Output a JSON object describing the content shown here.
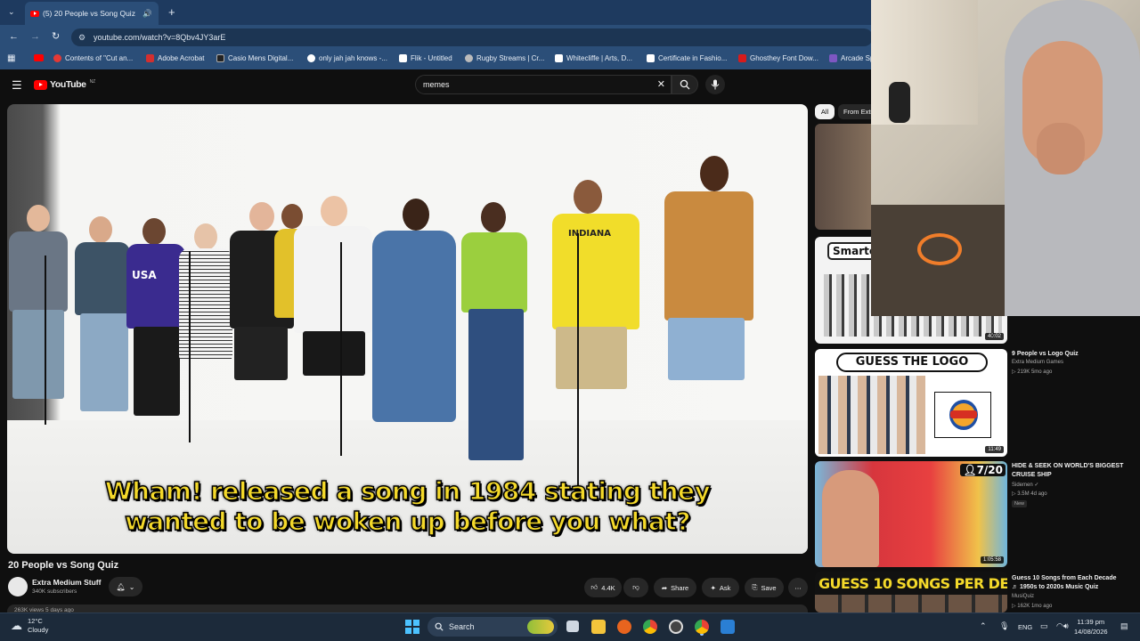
{
  "browser": {
    "tab_title": "(5) 20 People vs Song Quiz",
    "url": "youtube.com/watch?v=8Qbv4JY3arE",
    "bookmarks": [
      "Contents of \"Cut an...",
      "Adobe Acrobat",
      "Casio Mens Digital...",
      "only jah jah knows -...",
      "Flik - Untitled",
      "Rugby Streams | Cr...",
      "Whitecliffe | Arts, D...",
      "Certificate in Fashio...",
      "Ghosthey Font Dow...",
      "Arcade Sp"
    ]
  },
  "youtube": {
    "logo_text": "YouTube",
    "logo_region": "NZ",
    "search_value": "memes"
  },
  "video": {
    "caption_line1": "Wham! released a song in 1984 stating they",
    "caption_line2": "wanted to be woken up before you what?",
    "shirt_text_usa": "USA",
    "shirt_text_indiana": "INDIANA",
    "title": "20 People vs Song Quiz",
    "channel": "Extra Medium Stuff",
    "subscribers": "340K subscribers",
    "likes": "4.4K",
    "share_label": "Share",
    "ask_label": "Ask",
    "save_label": "Save",
    "meta_text": "263K views  5 days ago"
  },
  "sidebar": {
    "chips": [
      "All",
      "From Extra"
    ],
    "items": [
      {
        "thumb_text": "",
        "duration": ""
      },
      {
        "thumb_text": "Smarte",
        "duration": "40:02"
      },
      {
        "thumb_text": "GUESS THE LOGO",
        "duration": "11:49",
        "title": "9 People vs Logo Quiz",
        "channel": "Extra Medium Games",
        "meta": "219K  5mo ago"
      },
      {
        "thumb_text": "7/20",
        "duration": "1:05:58",
        "title": "HIDE & SEEK ON WORLD'S BIGGEST CRUISE SHIP",
        "channel": "Sidemen",
        "meta": "3.5M  4d ago",
        "badge": "New"
      },
      {
        "thumb_text": "GUESS 10 SONGS PER DECADE",
        "title": "Guess 10 Songs from Each Decade",
        "title2": "1950s to 2020s Music Quiz",
        "channel": "MusiQuiz",
        "meta": "162K  1mo ago"
      }
    ]
  },
  "taskbar": {
    "temperature": "12°C",
    "condition": "Cloudy",
    "search_label": "Search",
    "language": "ENG",
    "time": "11:39 pm",
    "date": "14/08/2026"
  },
  "colors": {
    "browser_chrome": "#2b4e78",
    "youtube_bg": "#0f0f0f",
    "caption_yellow": "#f4d92a",
    "youtube_red": "#ff0000"
  }
}
